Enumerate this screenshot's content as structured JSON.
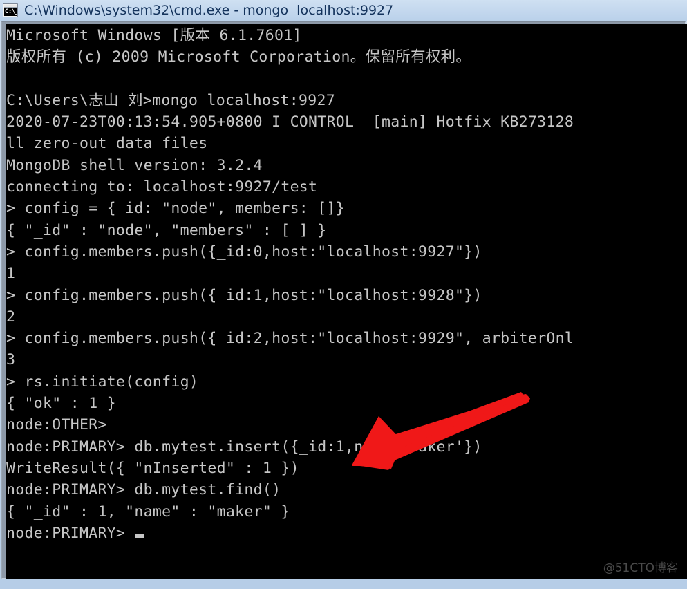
{
  "window": {
    "title": "C:\\Windows\\system32\\cmd.exe - mongo  localhost:9927",
    "icon": "cmd-console-icon",
    "icon_glyph": "C:\\_",
    "background_color": "#000000",
    "text_color": "#c6c6c6",
    "titlebar_color": "#c4d8ee",
    "title_text_color": "#14335c"
  },
  "terminal": {
    "lines": [
      "Microsoft Windows [版本 6.1.7601]",
      "版权所有 (c) 2009 Microsoft Corporation。保留所有权利。",
      "",
      "C:\\Users\\志山 刘>mongo localhost:9927",
      "2020-07-23T00:13:54.905+0800 I CONTROL  [main] Hotfix KB273128",
      "ll zero-out data files",
      "MongoDB shell version: 3.2.4",
      "connecting to: localhost:9927/test",
      "> config = {_id: \"node\", members: []}",
      "{ \"_id\" : \"node\", \"members\" : [ ] }",
      "> config.members.push({_id:0,host:\"localhost:9927\"})",
      "1",
      "> config.members.push({_id:1,host:\"localhost:9928\"})",
      "2",
      "> config.members.push({_id:2,host:\"localhost:9929\", arbiterOnl",
      "3",
      "> rs.initiate(config)",
      "{ \"ok\" : 1 }",
      "node:OTHER>",
      "node:PRIMARY> db.mytest.insert({_id:1,name:'maker'})",
      "WriteResult({ \"nInserted\" : 1 })",
      "node:PRIMARY> db.mytest.find()",
      "{ \"_id\" : 1, \"name\" : \"maker\" }",
      "node:PRIMARY> "
    ],
    "cursor_line_index": 23,
    "cursor_visible": true
  },
  "annotation": {
    "arrow_color": "#f01818",
    "arrow_name": "red-pointer-arrow",
    "points_from": "745,540",
    "points_to": "505,640"
  },
  "watermark": {
    "text": "@51CTO博客"
  }
}
